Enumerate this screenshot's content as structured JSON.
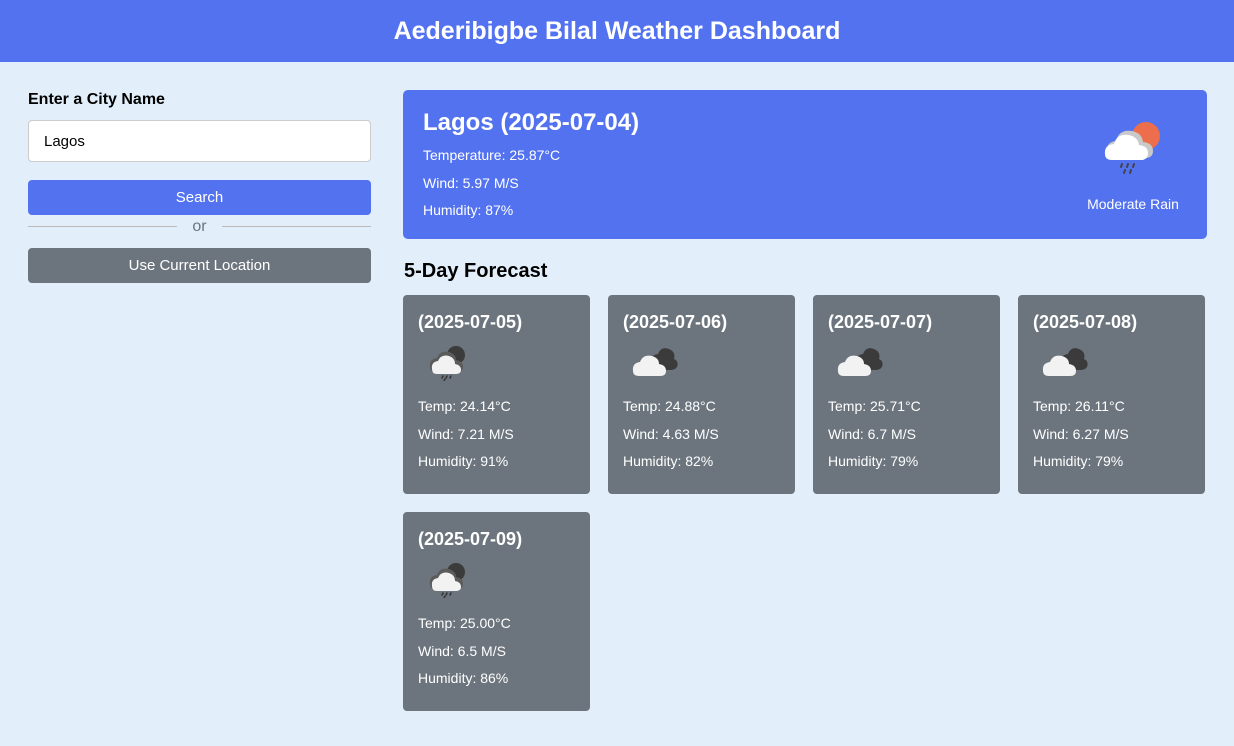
{
  "header": {
    "title": "Aederibigbe Bilal Weather Dashboard"
  },
  "input": {
    "label": "Enter a City Name",
    "value": "Lagos",
    "search_label": "Search",
    "separator_text": "or",
    "location_label": "Use Current Location"
  },
  "current": {
    "heading": "Lagos (2025-07-04)",
    "temperature": "Temperature: 25.87°C",
    "wind": "Wind: 5.97 M/S",
    "humidity": "Humidity: 87%",
    "description": "Moderate Rain",
    "icon": "rain-cloud-sun-icon"
  },
  "forecast": {
    "title": "5-Day Forecast",
    "days": [
      {
        "date": "(2025-07-05)",
        "temp": "Temp: 24.14°C",
        "wind": "Wind: 7.21 M/S",
        "humidity": "Humidity: 91%",
        "icon": "rain-cloud-icon"
      },
      {
        "date": "(2025-07-06)",
        "temp": "Temp: 24.88°C",
        "wind": "Wind: 4.63 M/S",
        "humidity": "Humidity: 82%",
        "icon": "broken-clouds-icon"
      },
      {
        "date": "(2025-07-07)",
        "temp": "Temp: 25.71°C",
        "wind": "Wind: 6.7 M/S",
        "humidity": "Humidity: 79%",
        "icon": "broken-clouds-icon"
      },
      {
        "date": "(2025-07-08)",
        "temp": "Temp: 26.11°C",
        "wind": "Wind: 6.27 M/S",
        "humidity": "Humidity: 79%",
        "icon": "broken-clouds-icon"
      },
      {
        "date": "(2025-07-09)",
        "temp": "Temp: 25.00°C",
        "wind": "Wind: 6.5 M/S",
        "humidity": "Humidity: 86%",
        "icon": "rain-cloud-icon"
      }
    ]
  },
  "colors": {
    "accent": "#5372f0",
    "secondary": "#6c757d",
    "background": "#e2effb"
  }
}
